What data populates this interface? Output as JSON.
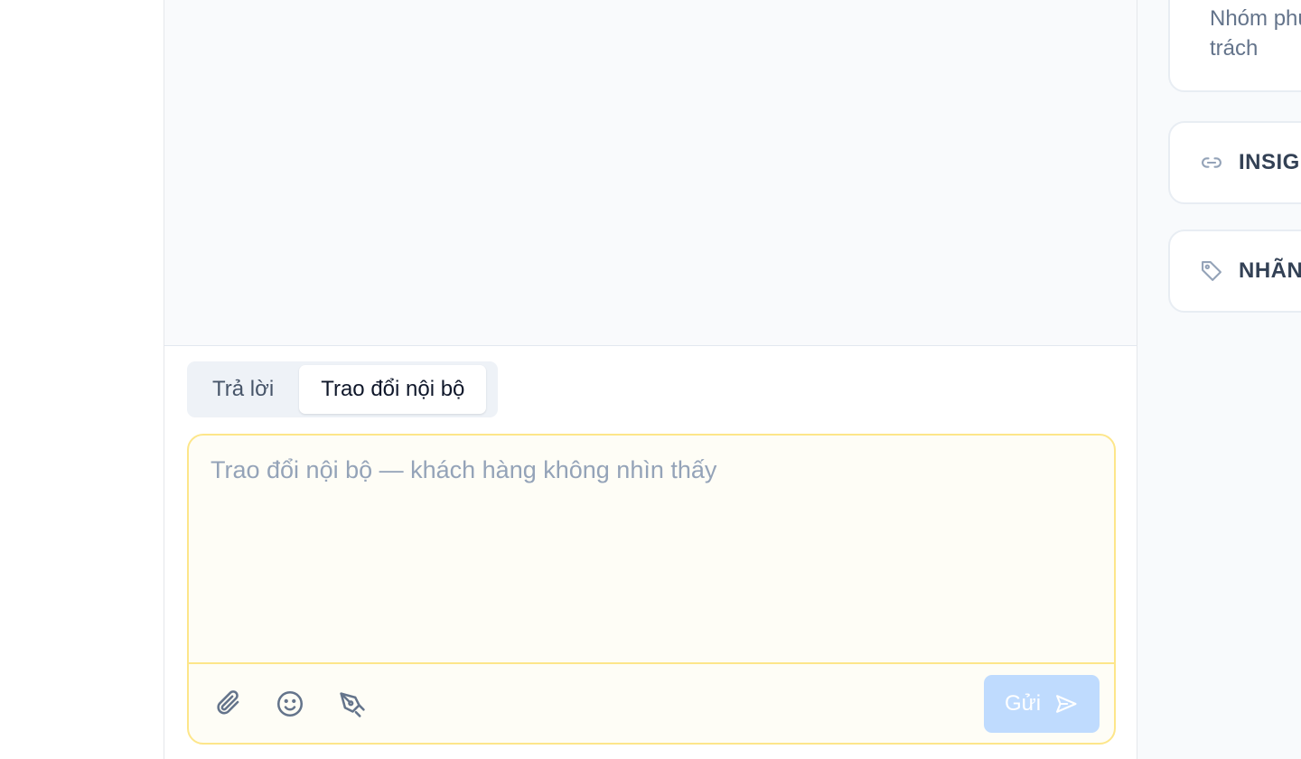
{
  "composer": {
    "tabs": [
      {
        "label": "Trả lời",
        "active": false
      },
      {
        "label": "Trao đổi nội bộ",
        "active": true
      }
    ],
    "note": {
      "placeholder": "Trao đổi nội bộ — khách hàng không nhìn thấy",
      "value": ""
    },
    "toolbar": {
      "attach_icon": "paperclip-icon",
      "emoji_icon": "smile-icon",
      "signature_icon": "pen-nib-icon"
    },
    "send": {
      "label": "Gửi",
      "icon": "send-icon",
      "disabled": true
    }
  },
  "details": {
    "team_text": "Nhóm phụ trách",
    "sections": [
      {
        "title": "INSIGHT",
        "icon": "link-icon"
      },
      {
        "title": "NHÃN",
        "icon": "tag-icon"
      }
    ]
  },
  "colors": {
    "note_bg": "#fefdf6",
    "note_border": "#fde68a",
    "send_disabled": "#bfdbfe",
    "thread_bg": "#f9fafc",
    "panel_bg": "#f8fafc"
  }
}
